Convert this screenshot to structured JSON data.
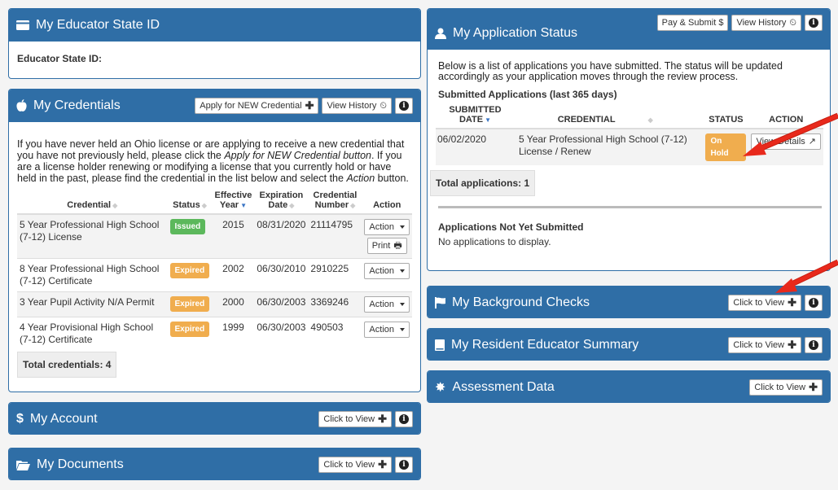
{
  "educator_id": {
    "title": "My Educator State ID",
    "label": "Educator State ID:"
  },
  "credentials": {
    "title": "My Credentials",
    "apply_label": "Apply for NEW Credential",
    "history_label": "View History",
    "desc_a": "If you have never held an Ohio license or are applying to receive a new credential that you have not previously held, please click the ",
    "desc_em1": "Apply for NEW Credential button",
    "desc_b": ". If you are a license holder renewing or modifying a license that you currently hold or have held in the past, please find the credential in the list below and select the ",
    "desc_em2": "Action",
    "desc_c": " button.",
    "headers": [
      "Credential",
      "Status",
      "Effective Year",
      "Expiration Date",
      "Credential Number",
      "Action"
    ],
    "rows": [
      {
        "credential": "5 Year Professional High School (7-12) License",
        "status": "Issued",
        "year": "2015",
        "expiration": "08/31/2020",
        "number": "21114795",
        "action": "Action",
        "print": "Print"
      },
      {
        "credential": "8 Year Professional High School (7-12) Certificate",
        "status": "Expired",
        "year": "2002",
        "expiration": "06/30/2010",
        "number": "2910225",
        "action": "Action"
      },
      {
        "credential": "3 Year Pupil Activity N/A Permit",
        "status": "Expired",
        "year": "2000",
        "expiration": "06/30/2003",
        "number": "3369246",
        "action": "Action"
      },
      {
        "credential": "4 Year Provisional High School (7-12) Certificate",
        "status": "Expired",
        "year": "1999",
        "expiration": "06/30/2003",
        "number": "490503",
        "action": "Action"
      }
    ],
    "total": "Total credentials: 4"
  },
  "account": {
    "title": "My Account",
    "view_label": "Click to View"
  },
  "documents": {
    "title": "My Documents",
    "view_label": "Click to View"
  },
  "application": {
    "title": "My Application Status",
    "pay_label": "Pay & Submit $",
    "history_label": "View History",
    "desc": "Below is a list of applications you have submitted. The status will be updated accordingly as your application moves through the review process.",
    "submitted_heading": "Submitted Applications (last 365 days)",
    "headers": [
      "SUBMITTED DATE",
      "CREDENTIAL",
      "STATUS",
      "ACTION"
    ],
    "rows": [
      {
        "date": "06/02/2020",
        "credential": "5 Year Professional High School (7-12) License / Renew",
        "status": "On Hold",
        "action": "View Details"
      }
    ],
    "total": "Total applications: 1",
    "not_submitted_heading": "Applications Not Yet Submitted",
    "none_text": "No applications to display."
  },
  "background": {
    "title": "My Background Checks",
    "view_label": "Click to View"
  },
  "resident": {
    "title": "My Resident Educator Summary",
    "view_label": "Click to View"
  },
  "assessment": {
    "title": "Assessment Data",
    "view_label": "Click to View"
  },
  "colors": {
    "panel_header": "#2f6ea6",
    "issued": "#5cb85c",
    "expired": "#f0ad4e",
    "arrow": "#e8291c"
  }
}
